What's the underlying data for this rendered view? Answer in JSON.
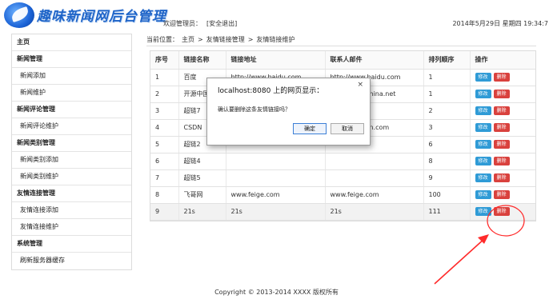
{
  "header": {
    "logo_text": "趣味新闻网后台管理",
    "welcome": "欢迎管理员：",
    "logout": "[安全退出]",
    "datetime": "2014年5月29日 星期四 19:34:7"
  },
  "sidebar": {
    "items": [
      {
        "label": "主页",
        "type": "head"
      },
      {
        "label": "新闻管理",
        "type": "head"
      },
      {
        "label": "新闻添加",
        "type": "item"
      },
      {
        "label": "新闻维护",
        "type": "item"
      },
      {
        "label": "新闻评论管理",
        "type": "head"
      },
      {
        "label": "新闻评论维护",
        "type": "item"
      },
      {
        "label": "新闻类别管理",
        "type": "head"
      },
      {
        "label": "新闻类别添加",
        "type": "item"
      },
      {
        "label": "新闻类别维护",
        "type": "item"
      },
      {
        "label": "友情连接管理",
        "type": "head"
      },
      {
        "label": "友情连接添加",
        "type": "item"
      },
      {
        "label": "友情连接维护",
        "type": "item"
      },
      {
        "label": "系统管理",
        "type": "head"
      },
      {
        "label": "刷新服务器缓存",
        "type": "item"
      }
    ]
  },
  "breadcrumb": {
    "prefix": "当前位置：",
    "home": "主页",
    "sep1": ">",
    "section": "友情链接管理",
    "sep2": ">",
    "current": "友情链接维护"
  },
  "table": {
    "headers": [
      "序号",
      "链接名称",
      "链接地址",
      "联系人邮件",
      "排列顺序",
      "操作"
    ],
    "edit_label": "修改",
    "delete_label": "删除",
    "rows": [
      {
        "no": "1",
        "name": "百度",
        "url": "http://www.baidu.com",
        "email": "http://www.baidu.com",
        "order": "1"
      },
      {
        "no": "2",
        "name": "开源中国",
        "url": "",
        "email": "hina.net",
        "order": "1"
      },
      {
        "no": "3",
        "name": "超链7",
        "url": "",
        "email": "",
        "order": "2"
      },
      {
        "no": "4",
        "name": "CSDN",
        "url": "",
        "email": "n.com",
        "order": "3"
      },
      {
        "no": "5",
        "name": "超链2",
        "url": "",
        "email": "",
        "order": "6"
      },
      {
        "no": "6",
        "name": "超链4",
        "url": "",
        "email": "",
        "order": "8"
      },
      {
        "no": "7",
        "name": "超链5",
        "url": "",
        "email": "",
        "order": "9"
      },
      {
        "no": "8",
        "name": "飞哥网",
        "url": "www.feige.com",
        "email": "www.feige.com",
        "order": "100"
      },
      {
        "no": "9",
        "name": "21s",
        "url": "21s",
        "email": "21s",
        "order": "111"
      }
    ]
  },
  "dialog": {
    "title": "localhost:8080 上的网页显示：",
    "close": "×",
    "message": "确认要删除这条友情链接吗？",
    "ok": "确定",
    "cancel": "取消"
  },
  "footer": {
    "text": "Copyright © 2013-2014 XXXX 版权所有"
  },
  "colors": {
    "edit_button": "#2f9bd6",
    "delete_button": "#d9413d",
    "annotation": "#ff2b2b",
    "logo_blue": "#1e64c8"
  }
}
